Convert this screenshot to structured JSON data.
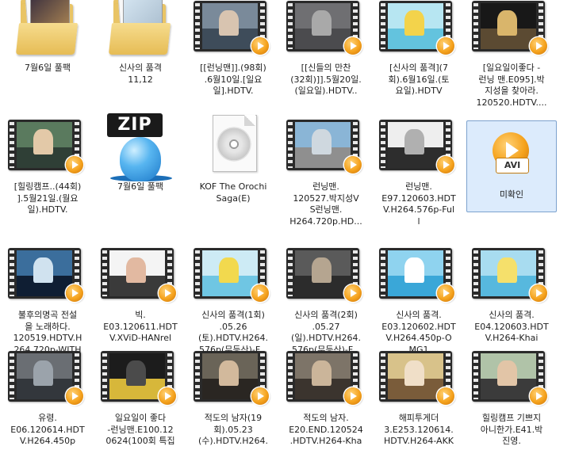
{
  "items": [
    {
      "label": "7월6일 풀팩",
      "type": "folder",
      "colors": [
        "#3a2f3e",
        "#c79a58"
      ]
    },
    {
      "label": "신사의 품격\n11,12",
      "type": "folder",
      "colors": [
        "#d6e6f2",
        "#9fb4c6"
      ]
    },
    {
      "label": "[[런닝맨]].(98회)\n.6월10일.[일요\n일].HDTV.",
      "type": "video",
      "colors": [
        "#7a8a9a",
        "#3e4c5a",
        "#d8c4b0"
      ]
    },
    {
      "label": "[[신들의 만찬\n(32회)]].5월20일.\n(일요일).HDTV..",
      "type": "video",
      "colors": [
        "#6f6f72",
        "#4b4b4e",
        "#a9a9a9"
      ]
    },
    {
      "label": "[신사의 품격](7\n회).6월16일.(토\n요일).HDTV",
      "type": "video",
      "colors": [
        "#b7e6f2",
        "#63c3de",
        "#f3d34b"
      ]
    },
    {
      "label": "[일요일이좋다 -\n런닝 맨.E095].박\n지성을 찾아라.\n120520.HDTV....",
      "type": "video",
      "colors": [
        "#181818",
        "#5b4a32",
        "#d9b56b"
      ]
    },
    {
      "label": "[힐링캠프..(44회)\n].5월21일.(월요\n일).HDTV.",
      "type": "video",
      "colors": [
        "#5a7a5e",
        "#2f3f36",
        "#e3c9a8"
      ]
    },
    {
      "label": "7월6일 풀팩",
      "type": "zip",
      "icon": "zip-archive-icon",
      "sign": "ZIP"
    },
    {
      "label": "KOF The Orochi\nSaga(E)",
      "type": "iso",
      "icon": "disc-image-icon"
    },
    {
      "label": "런닝맨.\n120527.박지성V\nS런닝맨.\nH264.720p.HD...",
      "type": "video",
      "colors": [
        "#8ab5d6",
        "#8f8f8f",
        "#cfd8df"
      ]
    },
    {
      "label": "런닝맨.\nE97.120603.HDT\nV.H264.576p-Ful\nl",
      "type": "video",
      "colors": [
        "#eeeeee",
        "#2d2d2d",
        "#b0b0b0"
      ]
    },
    {
      "label": "미확인",
      "type": "avi",
      "icon": "avi-file-icon",
      "tag": "AVI",
      "selected": true
    },
    {
      "label": "불후의명곡 전설\n을 노래하다.\n120519.HDTV.H\n264.720p-WITH",
      "type": "video",
      "colors": [
        "#3b6e9c",
        "#0f1e33",
        "#d0e2ef"
      ]
    },
    {
      "label": "빅.\nE03.120611.HDT\nV.XViD-HANrel",
      "type": "video",
      "colors": [
        "#f4f4f4",
        "#3a3a3a",
        "#e2b9a1"
      ]
    },
    {
      "label": "신사의 품격(1회)\n.05.26\n(토).HDTV.H264.\n576p(무등산)-F...",
      "type": "video",
      "colors": [
        "#cdebf5",
        "#6fc6e3",
        "#f2d94e"
      ]
    },
    {
      "label": "신사의 품격(2회)\n.05.27\n(일).HDTV.H264.\n576p(무등산)-F...",
      "type": "video",
      "colors": [
        "#5a5a5a",
        "#2c2c2c",
        "#b5a590"
      ]
    },
    {
      "label": "신사의 품격.\nE03.120602.HDT\nV.H264.450p-O\nMG1",
      "type": "video",
      "colors": [
        "#8fd3ef",
        "#3aa7d8",
        "#ffffff"
      ]
    },
    {
      "label": "신사의 품격.\nE04.120603.HDT\nV.H264-Khai",
      "type": "video",
      "colors": [
        "#a8dcf0",
        "#57b8de",
        "#f5e06b"
      ]
    },
    {
      "label": "유령.\nE06.120614.HDT\nV.H264.450p",
      "type": "video",
      "colors": [
        "#6a6e73",
        "#33373c",
        "#9ba3ab"
      ]
    },
    {
      "label": "일요일이 좋다\n-런닝맨.E100.12\n0624(100회 특집",
      "type": "video",
      "colors": [
        "#1c1c1c",
        "#d7b73a",
        "#4b4b4b"
      ]
    },
    {
      "label": "적도의 남자(19\n회).05.23\n(수).HDTV.H264.",
      "type": "video",
      "colors": [
        "#6a6458",
        "#2a2622",
        "#d2b99c"
      ]
    },
    {
      "label": "적도의 남자.\nE20.END.120524\n.HDTV.H264-Kha",
      "type": "video",
      "colors": [
        "#7d7468",
        "#3b342e",
        "#cbb59a"
      ]
    },
    {
      "label": "해피투게더\n3.E253.120614.\nHDTV.H264-AKK",
      "type": "video",
      "colors": [
        "#d8c28a",
        "#7a5c3a",
        "#f0dfc8"
      ]
    },
    {
      "label": "힐링캠프 기쁘지\n아니한가.E41.박\n진영.",
      "type": "video",
      "colors": [
        "#b0c3a8",
        "#3b3b3b",
        "#e2c5a7"
      ]
    }
  ]
}
